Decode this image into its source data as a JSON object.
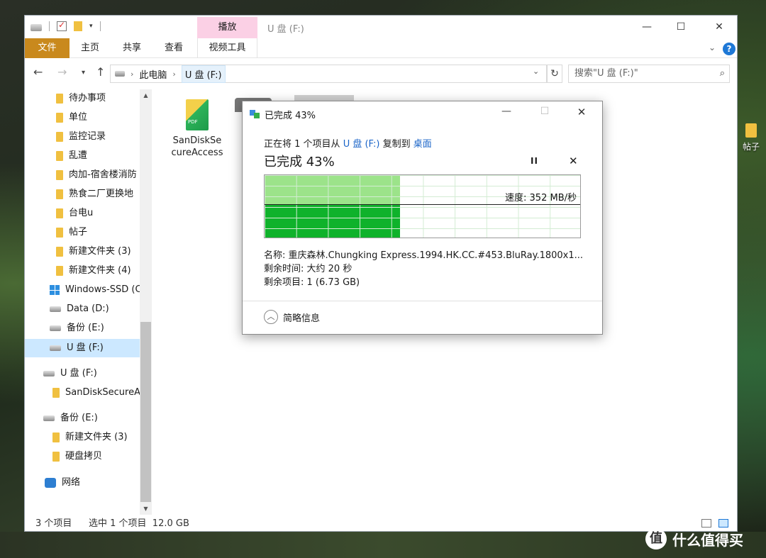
{
  "desktop": {
    "icon_label": "帖子",
    "watermark": "什么值得买"
  },
  "window": {
    "title": "U 盘 (F:)",
    "context_tab": "播放",
    "controls": {
      "minimize": "—",
      "maximize": "☐",
      "close": "✕"
    }
  },
  "ribbon": {
    "tabs": [
      "文件",
      "主页",
      "共享",
      "查看",
      "视频工具"
    ],
    "help": "?"
  },
  "address": {
    "segments": [
      "此电脑",
      "U 盘 (F:)"
    ],
    "search_placeholder": "搜索\"U 盘 (F:)\""
  },
  "nav": {
    "items": [
      {
        "label": "待办事项",
        "icon": "folder-icon"
      },
      {
        "label": "单位",
        "icon": "folder-icon"
      },
      {
        "label": "监控记录",
        "icon": "folder-icon"
      },
      {
        "label": "乱遭",
        "icon": "folder-icon"
      },
      {
        "label": "肉加-宿舍楼消防",
        "icon": "folder-icon"
      },
      {
        "label": "熟食二厂更换地",
        "icon": "folder-icon"
      },
      {
        "label": "台电u",
        "icon": "folder-icon"
      },
      {
        "label": "帖子",
        "icon": "folder-icon"
      },
      {
        "label": "新建文件夹 (3)",
        "icon": "folder-icon"
      },
      {
        "label": "新建文件夹 (4)",
        "icon": "folder-icon"
      },
      {
        "label": "Windows-SSD (C",
        "icon": "windows-drive-icon"
      },
      {
        "label": "Data (D:)",
        "icon": "drive-icon"
      },
      {
        "label": "备份 (E:)",
        "icon": "drive-icon"
      },
      {
        "label": "U 盘 (F:)",
        "icon": "drive-icon",
        "selected": true
      },
      {
        "label": "U 盘 (F:)",
        "icon": "drive-icon"
      },
      {
        "label": "SanDiskSecureAccess",
        "icon": "folder-icon"
      },
      {
        "label": "备份 (E:)",
        "icon": "drive-icon"
      },
      {
        "label": "新建文件夹 (3)",
        "icon": "folder-icon"
      },
      {
        "label": "硬盘拷贝",
        "icon": "folder-icon"
      },
      {
        "label": "网络",
        "icon": "network-icon"
      }
    ]
  },
  "files": [
    {
      "name": "SanDiskSecureAccess",
      "icon": "sandisk-app-icon"
    }
  ],
  "status": {
    "count": "3 个项目",
    "selection": "选中 1 个项目  12.0 GB"
  },
  "dialog": {
    "title": "已完成 43%",
    "line_prefix": "正在将 1 个项目从",
    "source": "U 盘 (F:)",
    "line_mid": "复制到",
    "destination": "桌面",
    "heading": "已完成 43%",
    "progress_fraction": 0.43,
    "speed": "速度: 352 MB/秒",
    "name_line": "名称: 重庆森林.Chungking Express.1994.HK.CC.#453.BluRay.1800x1...",
    "time_line": "剩余时间: 大约 20 秒",
    "items_line": "剩余项目: 1 (6.73 GB)",
    "less_info": "简略信息",
    "pause": "II",
    "stop": "✕",
    "colors": {
      "fill_light": "#9ce38a",
      "fill_dark": "#0fb22b",
      "link": "#1a64c8"
    }
  }
}
